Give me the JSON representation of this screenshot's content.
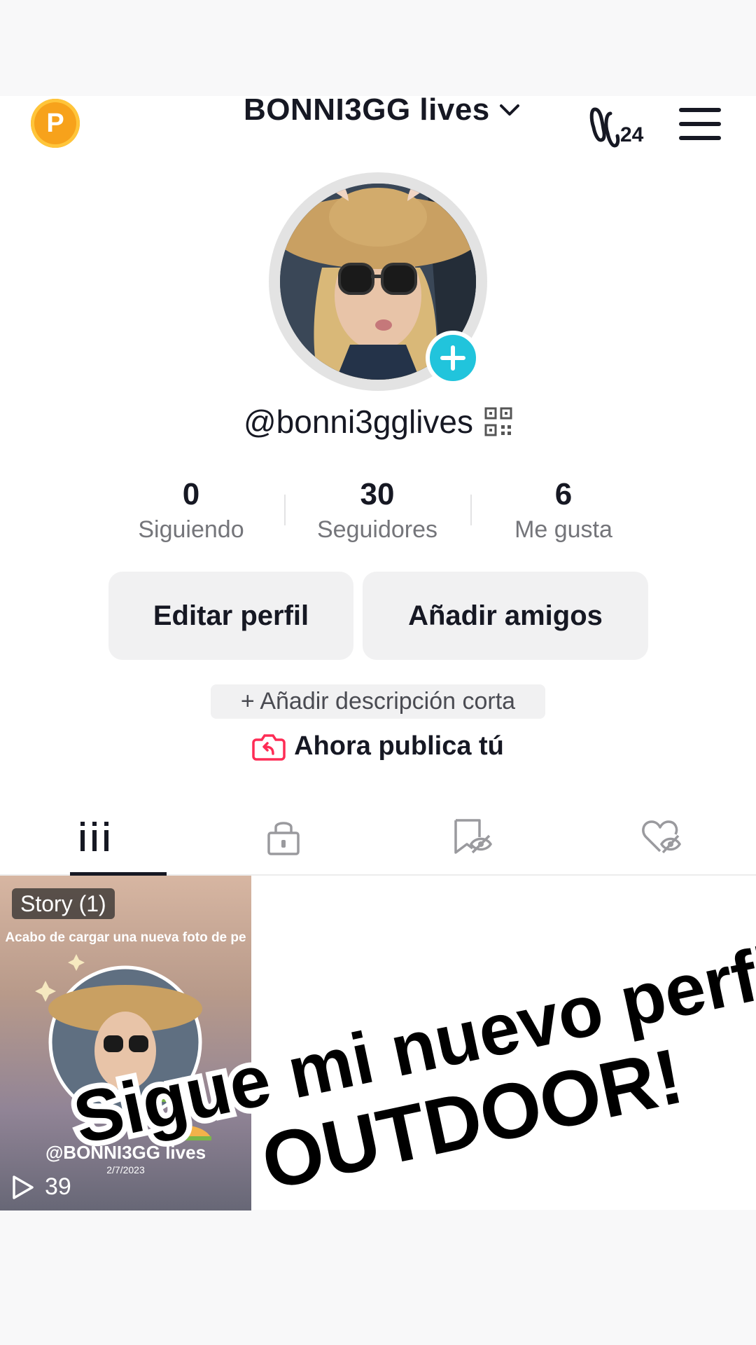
{
  "header": {
    "points_badge": "P",
    "account_name": "BONNI3GG lives",
    "footprint_count": "24"
  },
  "profile": {
    "username": "@bonni3gglives"
  },
  "stats": [
    {
      "value": "0",
      "label": "Siguiendo"
    },
    {
      "value": "30",
      "label": "Seguidores"
    },
    {
      "value": "6",
      "label": "Me gusta"
    }
  ],
  "actions": {
    "edit_profile": "Editar perfil",
    "add_friends": "Añadir amigos",
    "add_bio": "+ Añadir descripción corta",
    "publish_prompt": "Ahora publica tú"
  },
  "tabs": [
    {
      "icon": "grid-icon",
      "active": true
    },
    {
      "icon": "lock-icon",
      "active": false
    },
    {
      "icon": "bookmark-hidden-icon",
      "active": false
    },
    {
      "icon": "heart-hidden-icon",
      "active": false
    }
  ],
  "videos": [
    {
      "badge": "Story (1)",
      "caption": "Acabo de cargar una nueva foto de pe",
      "handle": "@BONNI3GG lives",
      "date": "2/7/2023",
      "views": "39"
    }
  ],
  "overlay_text": {
    "line1": "Sigue mi nuevo perfil",
    "line2": "OUTDOOR!"
  },
  "colors": {
    "accent_plus": "#21c4dc",
    "points_badge": "#f7a21b",
    "publish_icon": "#fe2c55"
  }
}
